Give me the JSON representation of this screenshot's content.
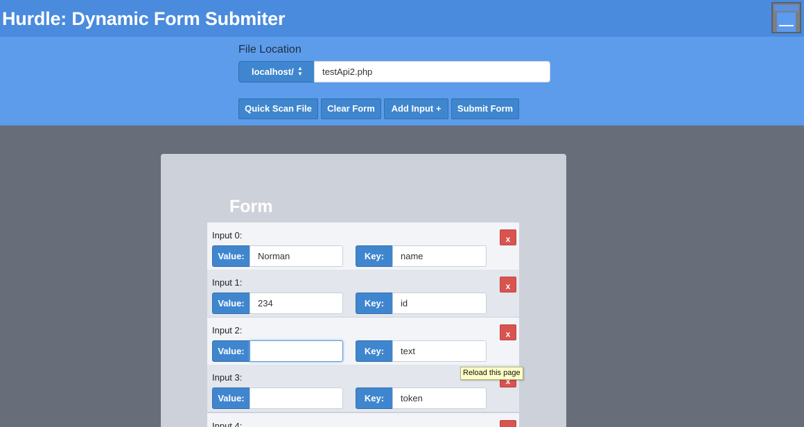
{
  "header": {
    "title": "Hurdle: Dynamic Form Submiter",
    "app_icon": "app-window-icon"
  },
  "toolbar": {
    "file_label": "File Location",
    "location_select": "localhost/",
    "file_input_value": "testApi2.php",
    "buttons": {
      "quick_scan": "Quick Scan File",
      "clear_form": "Clear Form",
      "add_input": "Add Input +",
      "submit_form": "Submit Form"
    }
  },
  "form": {
    "title": "Form",
    "rows": [
      {
        "label": "Input 0:",
        "value_tag": "Value:",
        "value": "Norman",
        "key_tag": "Key:",
        "key": "name",
        "delete": "x"
      },
      {
        "label": "Input 1:",
        "value_tag": "Value:",
        "value": "234",
        "key_tag": "Key:",
        "key": "id",
        "delete": "x"
      },
      {
        "label": "Input 2:",
        "value_tag": "Value:",
        "value": "",
        "key_tag": "Key:",
        "key": "text",
        "delete": "x"
      },
      {
        "label": "Input 3:",
        "value_tag": "Value:",
        "value": "",
        "key_tag": "Key:",
        "key": "token",
        "delete": "x"
      },
      {
        "label": "Input 4:",
        "value_tag": "",
        "value": "",
        "key_tag": "",
        "key": "",
        "delete": ""
      }
    ]
  },
  "tooltip": "Reload this page",
  "colors": {
    "header_bg": "#4a8bde",
    "toolbar_bg": "#5c9ceb",
    "button_bg": "#3f86cf",
    "delete_bg": "#d9534f",
    "page_bg": "#686e79"
  }
}
